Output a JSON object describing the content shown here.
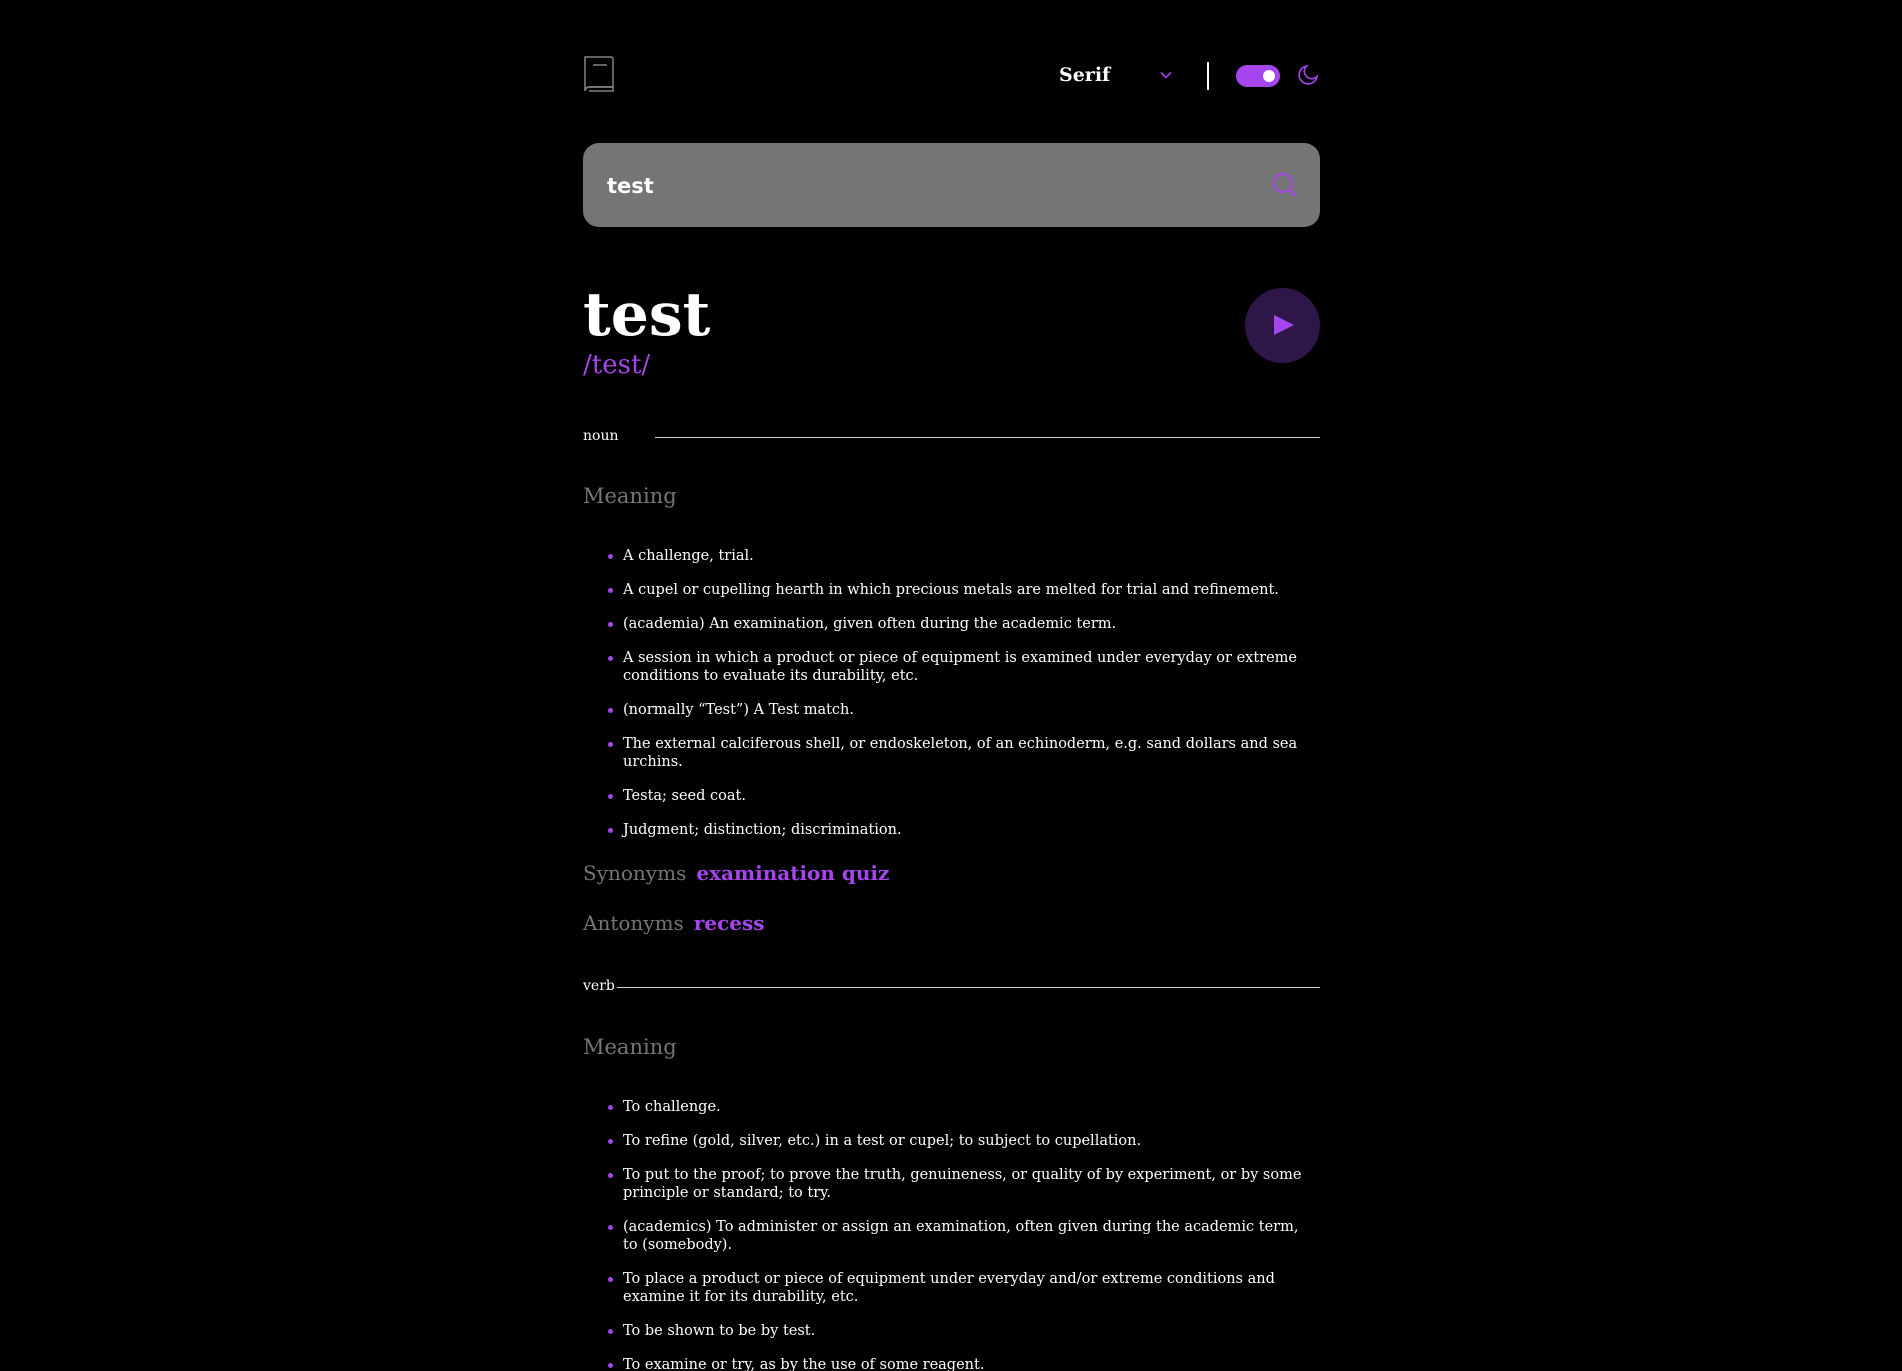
{
  "header": {
    "font_selected": "Serif",
    "theme": "dark"
  },
  "colors": {
    "accent": "#a445ed",
    "background": "#000000",
    "muted": "#757575",
    "search_bg": "#757575",
    "play_bg": "#2e1748"
  },
  "search": {
    "value": "test"
  },
  "entry": {
    "word": "test",
    "phonetic": "/test/"
  },
  "noun": {
    "pos": "noun",
    "meaning_heading": "Meaning",
    "definitions": [
      "A challenge, trial.",
      "A cupel or cupelling hearth in which precious metals are melted for trial and refinement.",
      "(academia) An examination, given often during the academic term.",
      "A session in which a product or piece of equipment is examined under everyday or extreme conditions to evaluate its durability, etc.",
      "(normally “Test”) A Test match.",
      "The external calciferous shell, or endoskeleton, of an echinoderm, e.g. sand dollars and sea urchins.",
      "Testa; seed coat.",
      "Judgment; distinction; discrimination."
    ],
    "synonyms_label": "Synonyms",
    "synonyms": "examination quiz",
    "antonyms_label": "Antonyms",
    "antonyms": "recess"
  },
  "verb": {
    "pos": "verb",
    "meaning_heading": "Meaning",
    "definitions": [
      "To challenge.",
      "To refine (gold, silver, etc.) in a test or cupel; to subject to cupellation.",
      "To put to the proof; to prove the truth, genuineness, or quality of by experiment, or by some principle or standard; to try.",
      "(academics) To administer or assign an examination, often given during the academic term, to (somebody).",
      "To place a product or piece of equipment under everyday and/or extreme conditions and examine it for its durability, etc.",
      "To be shown to be by test.",
      "To examine or try, as by the use of some reagent."
    ]
  }
}
